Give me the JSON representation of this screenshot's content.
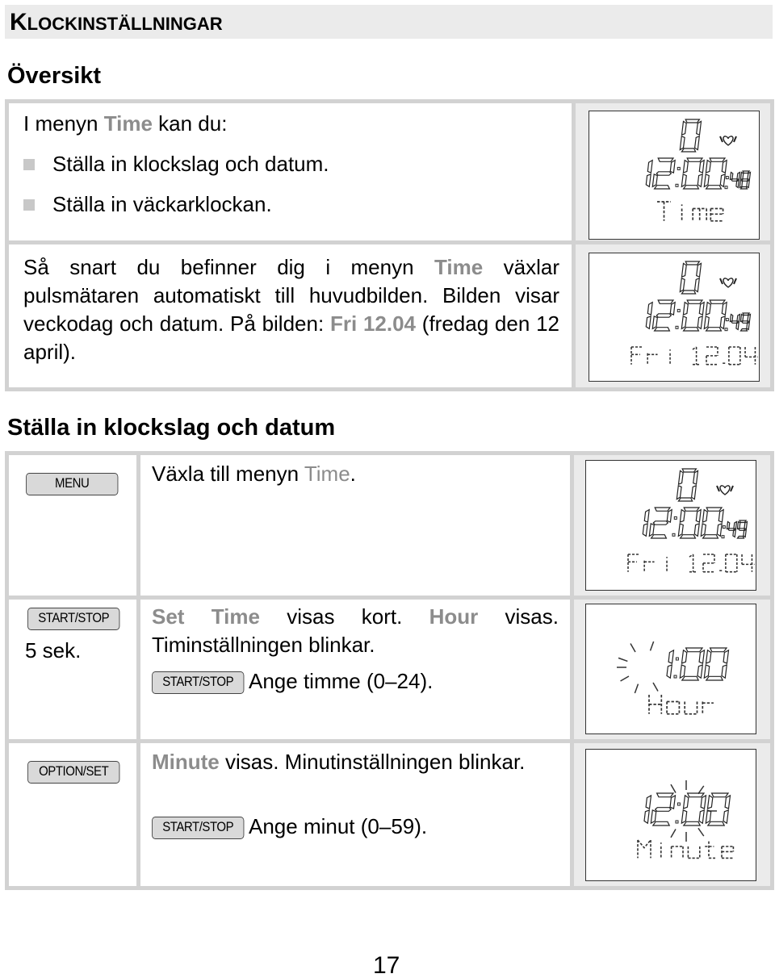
{
  "chapter_title": {
    "first": "K",
    "rest": "LOCKINSTÄLLNINGAR"
  },
  "overview": {
    "heading": "Översikt",
    "intro": {
      "pre": "I menyn ",
      "hl": "Time",
      "post": " kan du:"
    },
    "bullets": [
      "Ställa in klockslag och datum.",
      "Ställa in väckarklockan."
    ],
    "para": {
      "p1": "Så snart du befinner dig i menyn ",
      "hl1": "Time",
      "p2": " växlar pulsmätaren automatiskt till huvudbilden. Bilden visar veckodag och datum. På bilden: ",
      "hl2": "Fri 12.04",
      "p3": " (fredag den 12 april)."
    },
    "displays": [
      {
        "top_digit": "0",
        "time": "12:00",
        "seconds": "48",
        "label": "Time",
        "icon": "heart-icon"
      },
      {
        "top_digit": "0",
        "time": "12:00",
        "seconds": "49",
        "label": "Fri 12.04",
        "icon": "heart-icon"
      }
    ]
  },
  "steps_section": {
    "heading": "Ställa in klockslag och datum",
    "steps": [
      {
        "key": "MENU",
        "key_note": "",
        "text": {
          "pre": "Växla till menyn ",
          "hl": "Time",
          "post": "."
        },
        "display": {
          "top_digit": "0",
          "time": "12:00",
          "seconds": "49",
          "label": "Fri 12.04"
        }
      },
      {
        "key": "START/STOP",
        "key_note": "5 sek.",
        "text": {
          "hl1": "Set Time",
          "mid1": " visas kort. ",
          "hl2": "Hour",
          "mid2": " visas. Timinställningen blinkar."
        },
        "sub_key": "START/STOP",
        "sub_text": "Ange timme (0–24).",
        "display": {
          "time": "1:00",
          "label": "Hour",
          "blinking": "hour"
        }
      },
      {
        "key": "OPTION/SET",
        "key_note": "",
        "text": {
          "hl1": "Minute",
          "mid1": " visas. Minutinställningen blinkar."
        },
        "sub_key": "START/STOP",
        "sub_text": "Ange minut (0–59).",
        "display": {
          "time": "12:00",
          "label": "Minute",
          "blinking": "minute"
        }
      }
    ]
  },
  "page_number": "17",
  "colors": {
    "highlight": "#8c8c8c",
    "border": "#d2d2d2",
    "cell_gray": "#ebebeb",
    "key_fill": "#d9d9d9",
    "bullet": "#c8c8c8"
  }
}
